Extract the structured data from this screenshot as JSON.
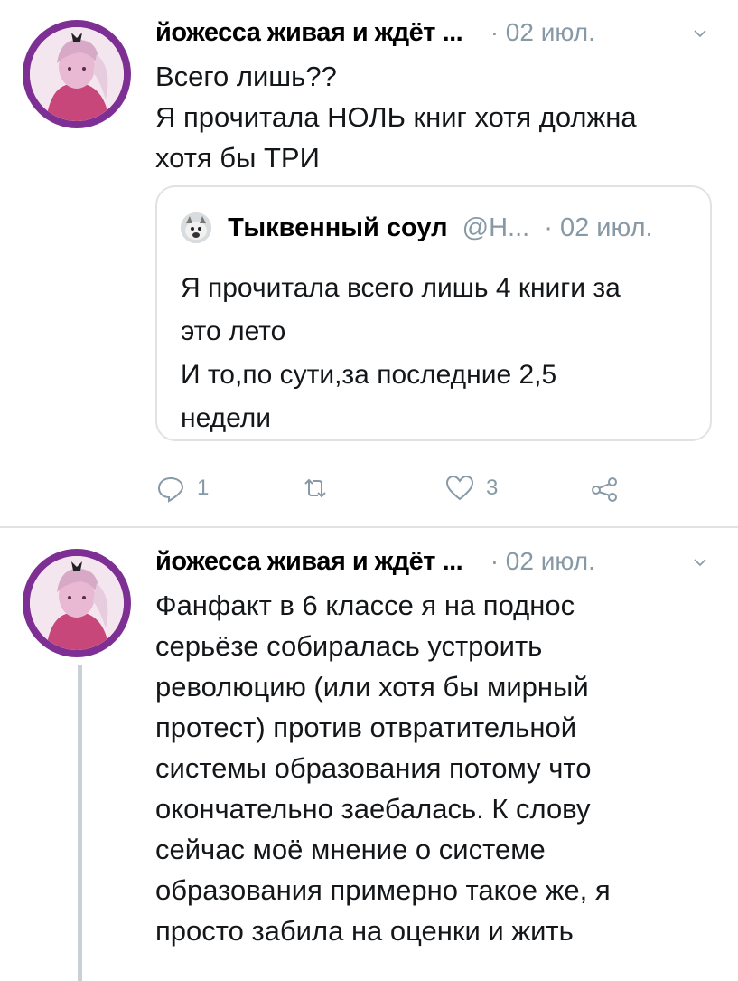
{
  "tweets": [
    {
      "author": "йожесса живая и ждёт ...",
      "date": "· 02 июл.",
      "text": "Всего лишь??\nЯ прочитала НОЛЬ книг хотя должна\nхотя бы ТРИ",
      "quote": {
        "author": "Тыквенный соул",
        "handle": "@Н...",
        "date": "· 02 июл.",
        "text": "Я прочитала всего лишь 4 книги за\nэто лето\nИ то,по сути,за последние 2,5\nнедели"
      },
      "actions": {
        "reply_count": "1",
        "retweet_count": "",
        "like_count": "3"
      }
    },
    {
      "author": "йожесса живая и ждёт ...",
      "date": "· 02 июл.",
      "text": "Фанфакт в 6 классе я на поднос\nсерьёзе собиралась устроить\nреволюцию (или хотя бы мирный\nпротест) против отвратительной\nсистемы образования потому что\nокончательно заебалась. К слову\nсейчас моё мнение о системе\nобразования примерно такое же, я\nпросто забила на оценки и жить"
    }
  ],
  "colors": {
    "avatar_ring": "#7d2f93",
    "muted": "#8899a6",
    "border": "#dfe3e6"
  },
  "icons": [
    "reply-icon",
    "retweet-icon",
    "like-icon",
    "share-icon",
    "chevron-down-icon"
  ]
}
